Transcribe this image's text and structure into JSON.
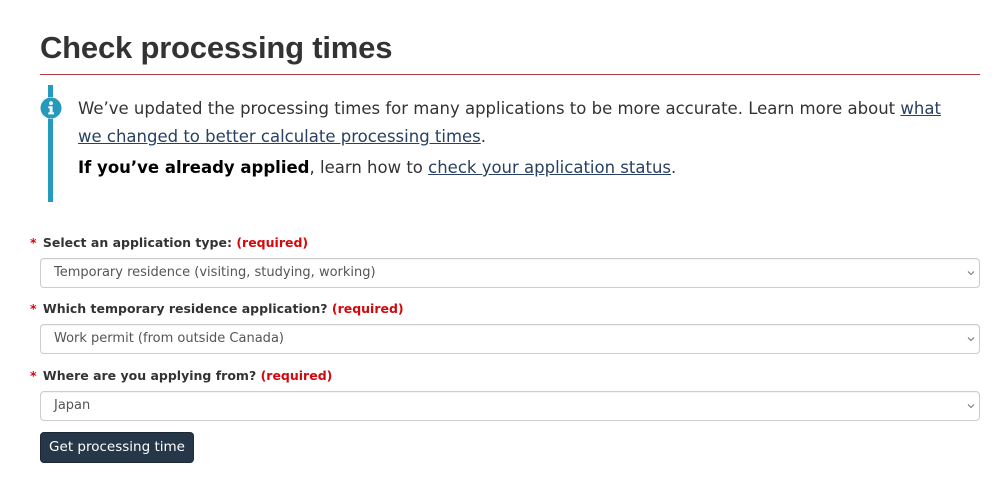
{
  "page": {
    "title": "Check processing times"
  },
  "notice": {
    "icon": "info-circle-icon",
    "intro": "We’ve updated the processing times for many applications to be more accurate. Learn more about ",
    "changes_link": "what we changed to better calculate processing times",
    "intro_end": ".",
    "applied_strong": "If you’ve already applied",
    "applied_text": ", learn how to ",
    "status_link": "check your application status",
    "applied_end": "."
  },
  "form": {
    "required_marker": "*",
    "application_type": {
      "label": "Select an application type:",
      "required": "(required)",
      "value": "Temporary residence (visiting, studying, working)"
    },
    "residence_application": {
      "label": "Which temporary residence application?",
      "required": "(required)",
      "value": "Work permit (from outside Canada)"
    },
    "applying_from": {
      "label": "Where are you applying from?",
      "required": "(required)",
      "value": "Japan"
    },
    "submit_label": "Get processing time"
  },
  "colors": {
    "title_rule": "#af3c43",
    "alert_bar": "#269abc",
    "link": "#284162",
    "required": "#d3080c",
    "button": "#26374a"
  }
}
